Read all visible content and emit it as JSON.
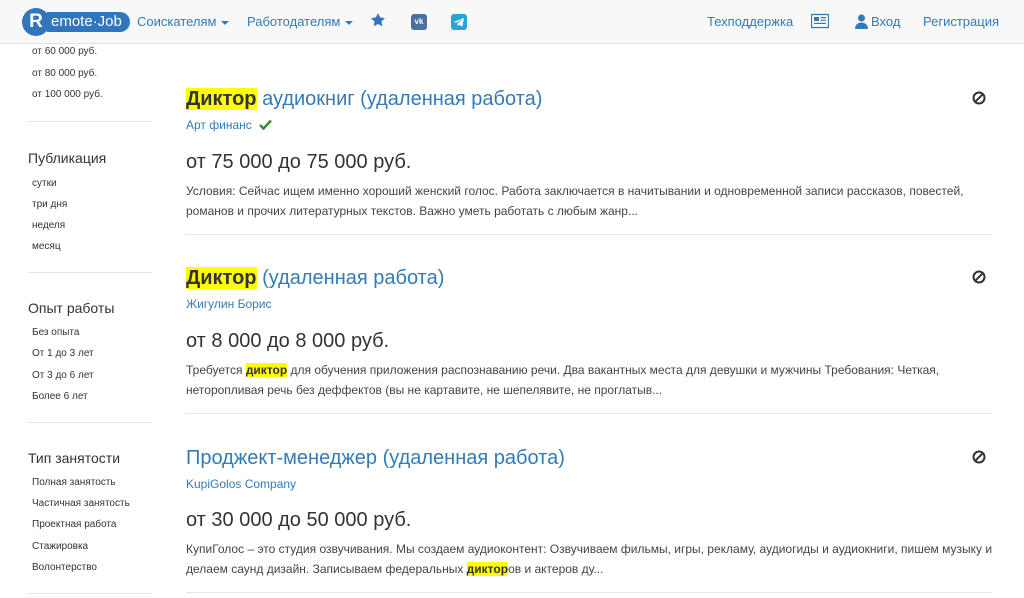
{
  "navbar": {
    "logo_letter": "R",
    "logo_text": "emote·Job",
    "job_seekers": "Соискателям",
    "employers": "Работодателям",
    "support": "Техподдержка",
    "login": "Вход",
    "register": "Регистрация",
    "vk_label": "vk"
  },
  "sidebar": {
    "salary_options": [
      "от 60 000 руб.",
      "от 80 000 руб.",
      "от 100 000 руб."
    ],
    "publication": {
      "heading": "Публикация",
      "items": [
        "сутки",
        "три дня",
        "неделя",
        "месяц"
      ]
    },
    "experience": {
      "heading": "Опыт работы",
      "items": [
        "Без опыта",
        "От 1 до 3 лет",
        "От 3 до 6 лет",
        "Более 6 лет"
      ]
    },
    "employment": {
      "heading": "Тип занятости",
      "items": [
        "Полная занятость",
        "Частичная занятость",
        "Проектная работа",
        "Стажировка",
        "Волонтерство"
      ]
    }
  },
  "jobs": [
    {
      "title_highlight": "Диктор",
      "title_rest": " аудиокниг (удаленная работа)",
      "company": "Арт финанс",
      "verified": true,
      "salary": "от 75 000 до 75 000 руб.",
      "desc_line1": "Условия: Сейчас ищем именно хороший женский голос. Работа заключается в начитывании и одновременной записи рассказов, повестей,",
      "desc_line2": "романов и прочих литературных текстов. Важно уметь работать с любым жанр..."
    },
    {
      "title_highlight": "Диктор",
      "title_rest": " (удаленная работа)",
      "company": "Жигулин Борис",
      "verified": false,
      "salary": "от 8 000 до 8 000 руб.",
      "desc_line1_pre": "Требуется ",
      "desc_line1_hl": "диктор",
      "desc_line1_post": " для обучения приложения распознаванию речи. Два вакантных места для девушки и мужчины Требования: Четкая,",
      "desc_line2": "неторопливая речь без деффектов (вы не картавите, не шепелявите, не проглатыв..."
    },
    {
      "title": "Проджект-менеджер (удаленная работа)",
      "company": "KupiGolos Company",
      "verified": false,
      "salary": "от 30 000 до 50 000 руб.",
      "desc_line1": "КупиГолос – это студия озвучивания. Мы создаем аудиоконтент: Озвучиваем фильмы, игры, рекламу, аудиогиды и аудиокниги, пишем музыку и",
      "desc_line2_pre": "делаем саунд дизайн. Записываем федеральных ",
      "desc_line2_hl": "диктор",
      "desc_line2_post": "ов и актеров ду..."
    }
  ],
  "colors": {
    "link": "#337ab7",
    "highlight": "#ffff00",
    "verified": "#3c8c3c",
    "logo": "#3176bd"
  },
  "icons": {
    "star": "star-icon",
    "vk": "vk-icon",
    "telegram": "telegram-icon",
    "news": "newspaper-icon",
    "user": "user-icon",
    "hide": "ban-icon",
    "verified": "check-icon"
  }
}
